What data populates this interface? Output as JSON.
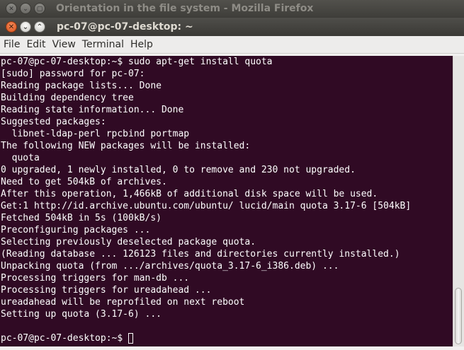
{
  "background_window": {
    "title": "Orientation in the file system - Mozilla Firefox"
  },
  "window": {
    "title": "pc-07@pc-07-desktop: ~"
  },
  "menubar": {
    "items": [
      "File",
      "Edit",
      "View",
      "Terminal",
      "Help"
    ]
  },
  "terminal": {
    "lines": [
      "pc-07@pc-07-desktop:~$ sudo apt-get install quota",
      "[sudo] password for pc-07:",
      "Reading package lists... Done",
      "Building dependency tree",
      "Reading state information... Done",
      "Suggested packages:",
      "  libnet-ldap-perl rpcbind portmap",
      "The following NEW packages will be installed:",
      "  quota",
      "0 upgraded, 1 newly installed, 0 to remove and 230 not upgraded.",
      "Need to get 504kB of archives.",
      "After this operation, 1,466kB of additional disk space will be used.",
      "Get:1 http://id.archive.ubuntu.com/ubuntu/ lucid/main quota 3.17-6 [504kB]",
      "Fetched 504kB in 5s (100kB/s)",
      "Preconfiguring packages ...",
      "Selecting previously deselected package quota.",
      "(Reading database ... 126123 files and directories currently installed.)",
      "Unpacking quota (from .../archives/quota_3.17-6_i386.deb) ...",
      "Processing triggers for man-db ...",
      "Processing triggers for ureadahead ...",
      "ureadahead will be reprofiled on next reboot",
      "Setting up quota (3.17-6) ...",
      ""
    ],
    "prompt": "pc-07@pc-07-desktop:~$ "
  },
  "colors": {
    "terminal_bg": "#300a24",
    "terminal_fg": "#ffffff",
    "close_button": "#e05a22"
  }
}
